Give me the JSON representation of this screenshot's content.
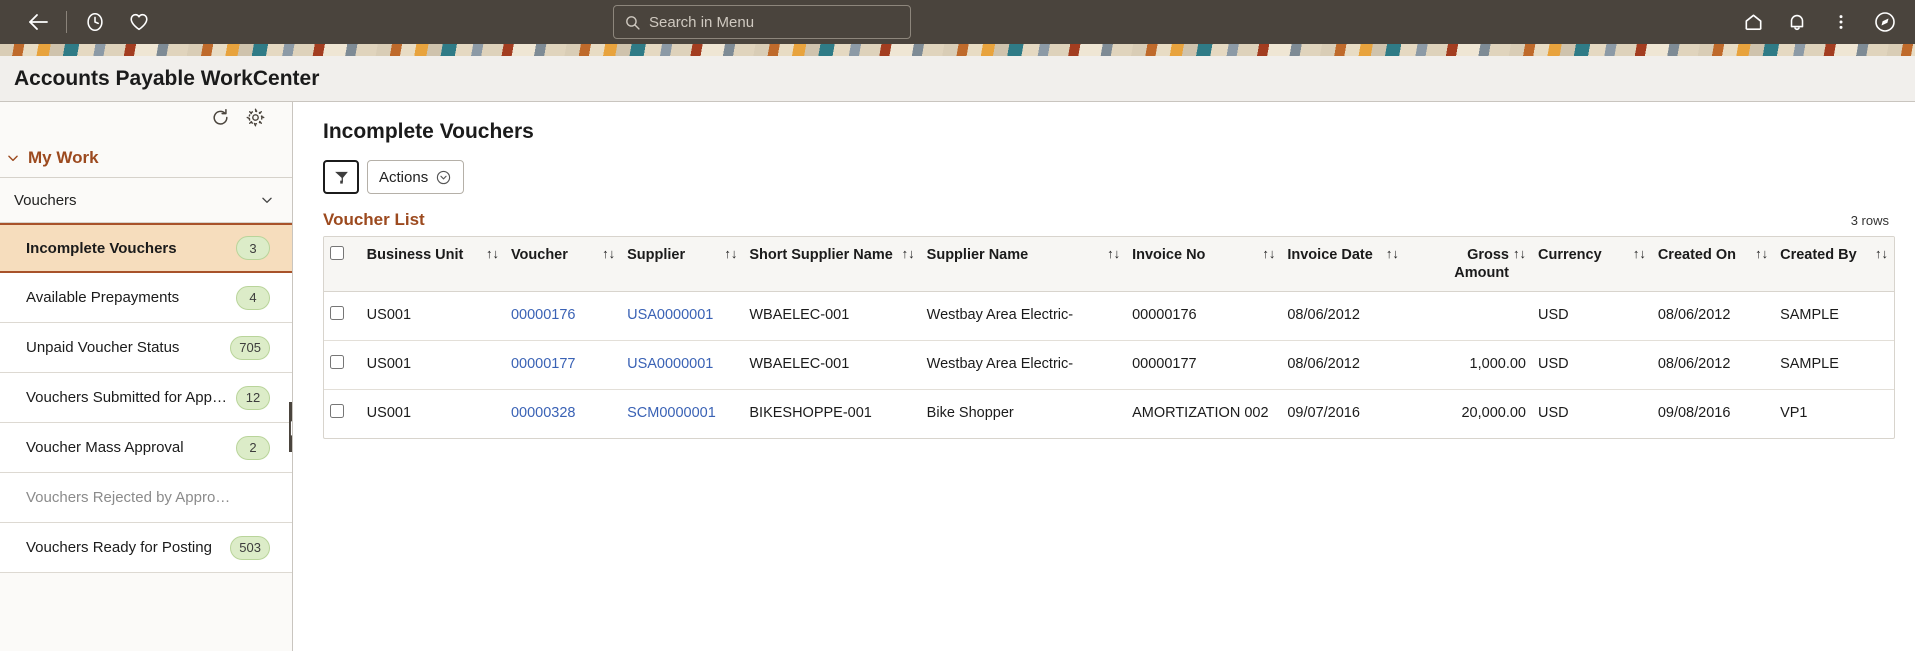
{
  "topbar": {
    "back_icon": "back-arrow-icon",
    "recents_icon": "clock-icon",
    "favorites_icon": "heart-icon",
    "home_icon": "home-icon",
    "notifications_icon": "bell-icon",
    "more_icon": "kebab-menu-icon",
    "navbar_icon": "compass-icon",
    "search": {
      "placeholder": "Search in Menu",
      "value": ""
    },
    "background": "#4a443d"
  },
  "page": {
    "title": "Accounts Payable WorkCenter"
  },
  "sidebar": {
    "refresh_icon": "refresh-icon",
    "settings_icon": "gear-icon",
    "section": {
      "label": "My Work",
      "expanded": true
    },
    "group": {
      "label": "Vouchers",
      "expanded": true
    },
    "collapse_handle": "⏸",
    "accent": "#9c4a1f",
    "items": [
      {
        "label": "Incomplete Vouchers",
        "badge": "3",
        "selected": true,
        "disabled": false
      },
      {
        "label": "Available Prepayments",
        "badge": "4",
        "selected": false,
        "disabled": false
      },
      {
        "label": "Unpaid Voucher Status",
        "badge": "705",
        "selected": false,
        "disabled": false
      },
      {
        "label": "Vouchers Submitted for App…",
        "badge": "12",
        "selected": false,
        "disabled": false
      },
      {
        "label": "Voucher Mass Approval",
        "badge": "2",
        "selected": false,
        "disabled": false
      },
      {
        "label": "Vouchers Rejected by Appro…",
        "badge": "",
        "selected": false,
        "disabled": true
      },
      {
        "label": "Vouchers Ready for Posting",
        "badge": "503",
        "selected": false,
        "disabled": false
      }
    ]
  },
  "main": {
    "title": "Incomplete Vouchers",
    "filter_icon": "funnel-filter-icon",
    "actions_label": "Actions",
    "actions_icon": "chevron-down-circle-icon",
    "list_title": "Voucher List",
    "row_count": "3 rows",
    "columns": [
      {
        "label": "Business Unit",
        "sort": "↑↓",
        "align": "left"
      },
      {
        "label": "Voucher",
        "sort": "↑↓",
        "align": "left"
      },
      {
        "label": "Supplier",
        "sort": "↑↓",
        "align": "left"
      },
      {
        "label": "Short Supplier Name",
        "sort": "↑↓",
        "align": "left"
      },
      {
        "label": "Supplier Name",
        "sort": "↑↓",
        "align": "left"
      },
      {
        "label": "Invoice No",
        "sort": "↑↓",
        "align": "left"
      },
      {
        "label": "Invoice Date",
        "sort": "↑↓",
        "align": "left"
      },
      {
        "label": "Gross Amount",
        "sort": "↑↓",
        "align": "right"
      },
      {
        "label": "Currency",
        "sort": "↑↓",
        "align": "left"
      },
      {
        "label": "Created On",
        "sort": "↑↓",
        "align": "left"
      },
      {
        "label": "Created By",
        "sort": "↑↓",
        "align": "left"
      }
    ],
    "rows": [
      {
        "business_unit": "US001",
        "voucher": "00000176",
        "supplier": "USA0000001",
        "short_supplier_name": "WBAELEC-001",
        "supplier_name": "Westbay Area Electric-",
        "invoice_no": "00000176",
        "invoice_date": "08/06/2012",
        "gross_amount": "",
        "currency": "USD",
        "created_on": "08/06/2012",
        "created_by": "SAMPLE"
      },
      {
        "business_unit": "US001",
        "voucher": "00000177",
        "supplier": "USA0000001",
        "short_supplier_name": "WBAELEC-001",
        "supplier_name": "Westbay Area Electric-",
        "invoice_no": "00000177",
        "invoice_date": "08/06/2012",
        "gross_amount": "1,000.00",
        "currency": "USD",
        "created_on": "08/06/2012",
        "created_by": "SAMPLE"
      },
      {
        "business_unit": "US001",
        "voucher": "00000328",
        "supplier": "SCM0000001",
        "short_supplier_name": "BIKESHOPPE-001",
        "supplier_name": "Bike Shopper",
        "invoice_no": "AMORTIZATION 002",
        "invoice_date": "09/07/2016",
        "gross_amount": "20,000.00",
        "currency": "USD",
        "created_on": "09/08/2016",
        "created_by": "VP1"
      }
    ]
  }
}
